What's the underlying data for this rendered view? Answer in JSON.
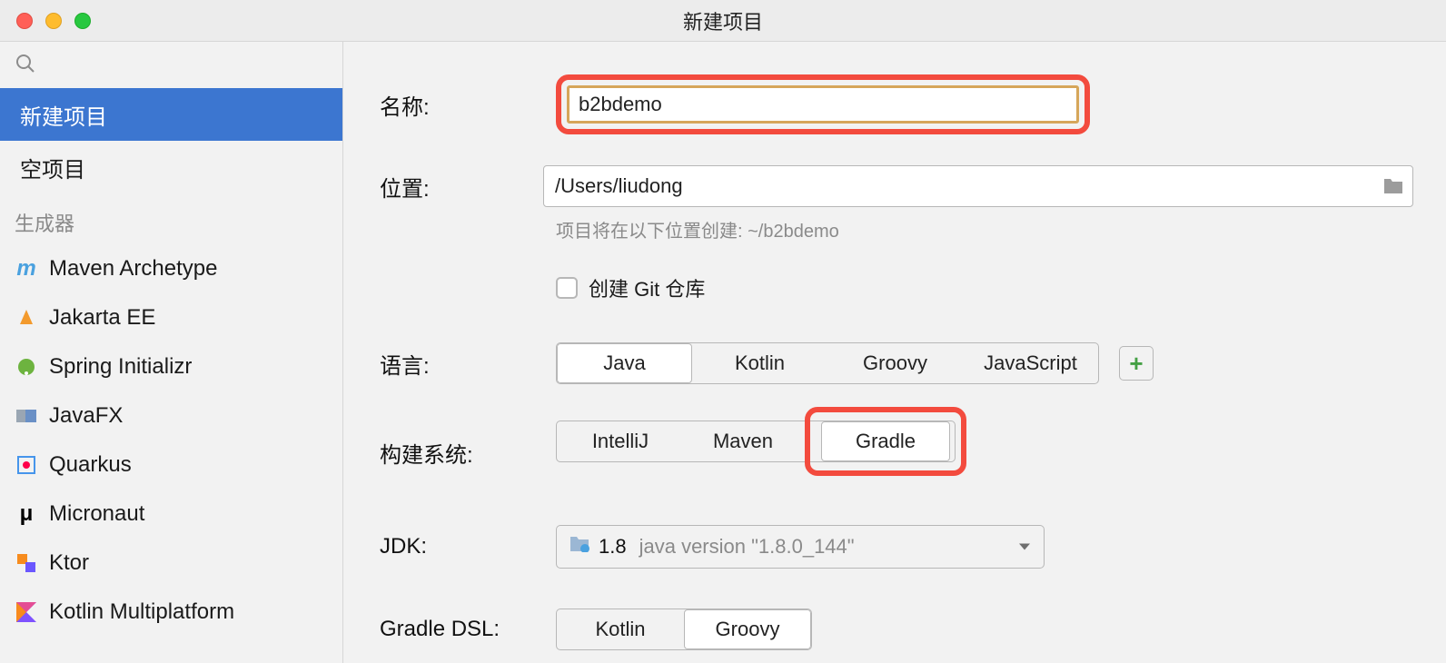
{
  "window": {
    "title": "新建项目"
  },
  "sidebar": {
    "items": [
      {
        "label": "新建项目",
        "selected": true
      },
      {
        "label": "空项目",
        "selected": false
      }
    ],
    "section": "生成器",
    "generators": [
      {
        "label": "Maven Archetype",
        "icon": "maven"
      },
      {
        "label": "Jakarta EE",
        "icon": "jakarta"
      },
      {
        "label": "Spring Initializr",
        "icon": "spring"
      },
      {
        "label": "JavaFX",
        "icon": "javafx"
      },
      {
        "label": "Quarkus",
        "icon": "quarkus"
      },
      {
        "label": "Micronaut",
        "icon": "micronaut"
      },
      {
        "label": "Ktor",
        "icon": "ktor"
      },
      {
        "label": "Kotlin Multiplatform",
        "icon": "kotlin"
      }
    ]
  },
  "form": {
    "name_label": "名称:",
    "name_value": "b2bdemo",
    "location_label": "位置:",
    "location_value": "/Users/liudong",
    "location_hint": "项目将在以下位置创建: ~/b2bdemo",
    "git_label": "创建 Git 仓库",
    "lang_label": "语言:",
    "langs": [
      "Java",
      "Kotlin",
      "Groovy",
      "JavaScript"
    ],
    "lang_selected": "Java",
    "build_label": "构建系统:",
    "builds": [
      "IntelliJ",
      "Maven",
      "Gradle"
    ],
    "build_selected": "Gradle",
    "jdk_label": "JDK:",
    "jdk_version": "1.8",
    "jdk_detail": "java version \"1.8.0_144\"",
    "dsl_label": "Gradle DSL:",
    "dsls": [
      "Kotlin",
      "Groovy"
    ],
    "dsl_selected": "Groovy",
    "plus": "+"
  }
}
